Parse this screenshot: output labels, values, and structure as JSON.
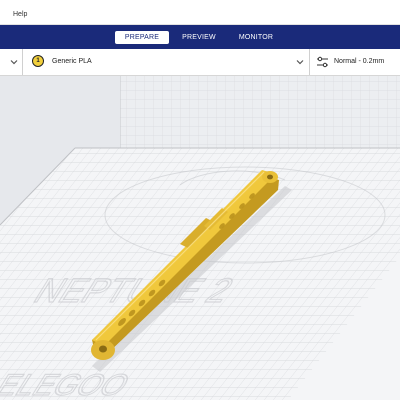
{
  "menu": {
    "help_label": "Help"
  },
  "stages": {
    "prepare": "PREPARE",
    "preview": "PREVIEW",
    "monitor": "MONITOR"
  },
  "material": {
    "extruder_number": "1",
    "name": "Generic PLA"
  },
  "print_settings": {
    "profile": "Normal - 0.2mm"
  },
  "build_plate": {
    "logo_line1": "NEPTUNE 2",
    "logo_line2": "ELEGOO"
  },
  "colors": {
    "stage_bar": "#1a2a7a",
    "model_fill": "#f0c83c",
    "plate_grid": "#d4d6da",
    "material_badge": "#f1cf3c"
  }
}
